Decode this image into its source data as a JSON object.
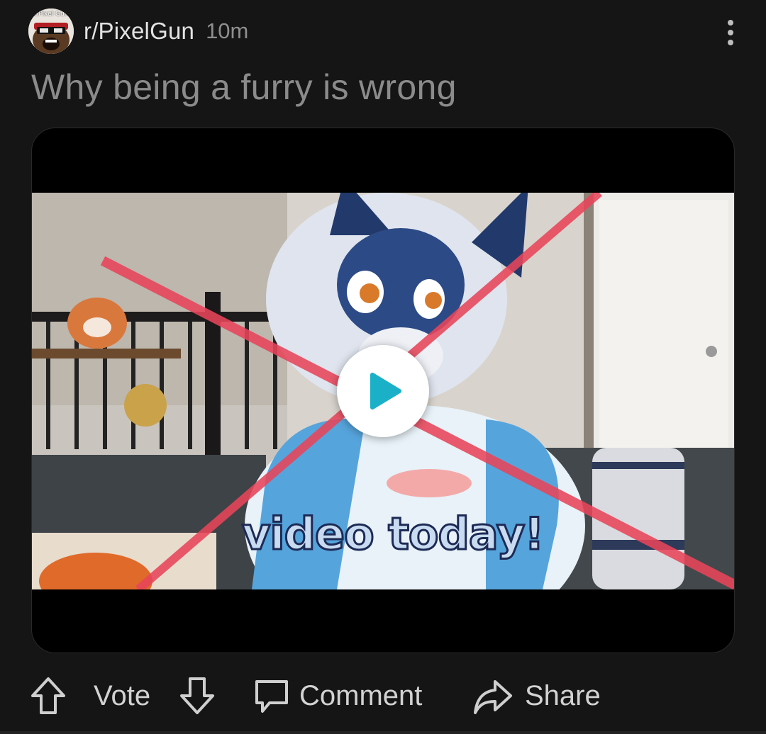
{
  "post": {
    "subreddit": "r/PixelGun",
    "avatar_label": "r/Pixel Gun",
    "time": "10m",
    "title": "Why being a furry is wrong"
  },
  "media": {
    "overlay_text": "video today!",
    "play_icon": "play-icon"
  },
  "actions": {
    "vote_label": "Vote",
    "comment_label": "Comment",
    "share_label": "Share"
  },
  "colors": {
    "background": "#151515",
    "play_accent": "#1ab0c8",
    "cross_mark": "#e8455a"
  }
}
